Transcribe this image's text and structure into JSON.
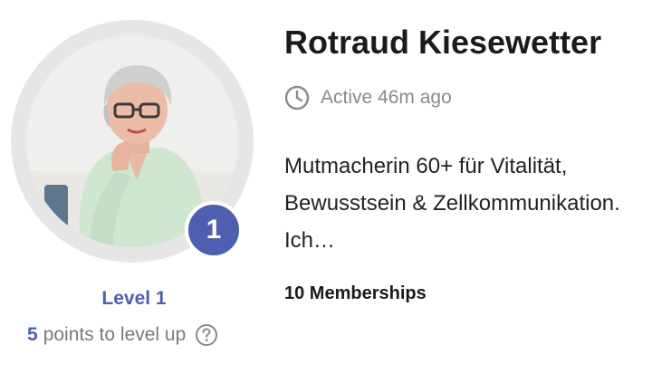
{
  "profile": {
    "name": "Rotraud Kiesewetter",
    "active": "Active 46m ago",
    "bio": "Mutmacherin 60+ für Vitalität, Bewusstsein & Zellkommunikation. Ich…",
    "memberships": "10 Memberships",
    "avatar_alt": "Rotraud Kiesewetter"
  },
  "level": {
    "badge_number": "1",
    "label": "Level 1",
    "points": "5",
    "points_suffix": "points to level up"
  },
  "icons": {
    "activity": "clock-icon",
    "help": "question-circle-icon"
  },
  "colors": {
    "accent": "#4e5fb0",
    "ring": "#e6e6e6",
    "muted_text": "#8a8a8a"
  }
}
